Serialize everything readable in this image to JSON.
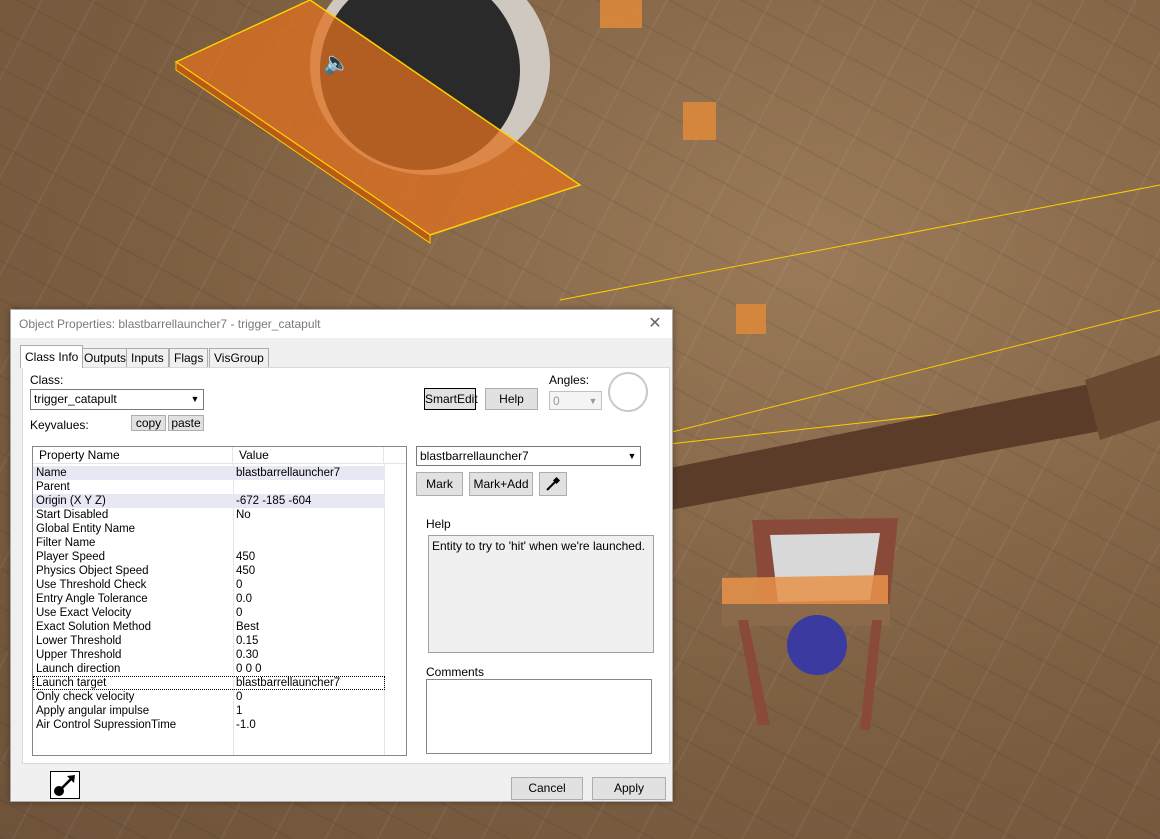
{
  "window": {
    "title": "Object Properties: blastbarrellauncher7 - trigger_catapult",
    "close_glyph": "✕"
  },
  "tabs": [
    {
      "label": "Class Info",
      "active": true
    },
    {
      "label": "Outputs"
    },
    {
      "label": "Inputs"
    },
    {
      "label": "Flags"
    },
    {
      "label": "VisGroup"
    }
  ],
  "class_info": {
    "class_label": "Class:",
    "class_value": "trigger_catapult",
    "keyvalues_label": "Keyvalues:",
    "copy_label": "copy",
    "paste_label": "paste",
    "smartedit_label": "SmartEdit",
    "help_button_label": "Help",
    "angles_label": "Angles:",
    "angles_value": "0"
  },
  "property_table": {
    "columns": [
      "Property Name",
      "Value"
    ],
    "rows": [
      {
        "name": "Name",
        "value": "blastbarrellauncher7"
      },
      {
        "name": "Parent",
        "value": ""
      },
      {
        "name": "Origin (X Y Z)",
        "value": "-672 -185 -604"
      },
      {
        "name": "Start Disabled",
        "value": "No"
      },
      {
        "name": "Global Entity Name",
        "value": ""
      },
      {
        "name": "Filter Name",
        "value": ""
      },
      {
        "name": "Player Speed",
        "value": "450"
      },
      {
        "name": "Physics Object Speed",
        "value": "450"
      },
      {
        "name": "Use Threshold Check",
        "value": "0"
      },
      {
        "name": "Entry Angle Tolerance",
        "value": "0.0"
      },
      {
        "name": "Use Exact Velocity",
        "value": "0"
      },
      {
        "name": "Exact Solution Method",
        "value": "Best"
      },
      {
        "name": "Lower Threshold",
        "value": "0.15"
      },
      {
        "name": "Upper Threshold",
        "value": "0.30"
      },
      {
        "name": "Launch direction",
        "value": "0 0 0"
      },
      {
        "name": "Launch target",
        "value": "blastbarrellauncher7"
      },
      {
        "name": "Only check velocity",
        "value": "0"
      },
      {
        "name": "Apply angular impulse",
        "value": "1"
      },
      {
        "name": "Air Control SupressionTime",
        "value": "-1.0"
      }
    ]
  },
  "value_editor": {
    "target_value": "blastbarrellauncher7",
    "mark_label": "Mark",
    "mark_add_label": "Mark+Add",
    "eyedropper_icon": "eyedropper-icon"
  },
  "help": {
    "label": "Help",
    "text": "Entity to try to 'hit' when we're launched."
  },
  "comments": {
    "label": "Comments",
    "value": ""
  },
  "footer": {
    "pin_icon": "pin-icon",
    "cancel_label": "Cancel",
    "apply_label": "Apply"
  },
  "colors": {
    "dialog_bg": "#f0f0f0",
    "selection_row": "#e8e8f4",
    "trigger_orange": "#e07020",
    "selection_outline": "#ffd000"
  }
}
